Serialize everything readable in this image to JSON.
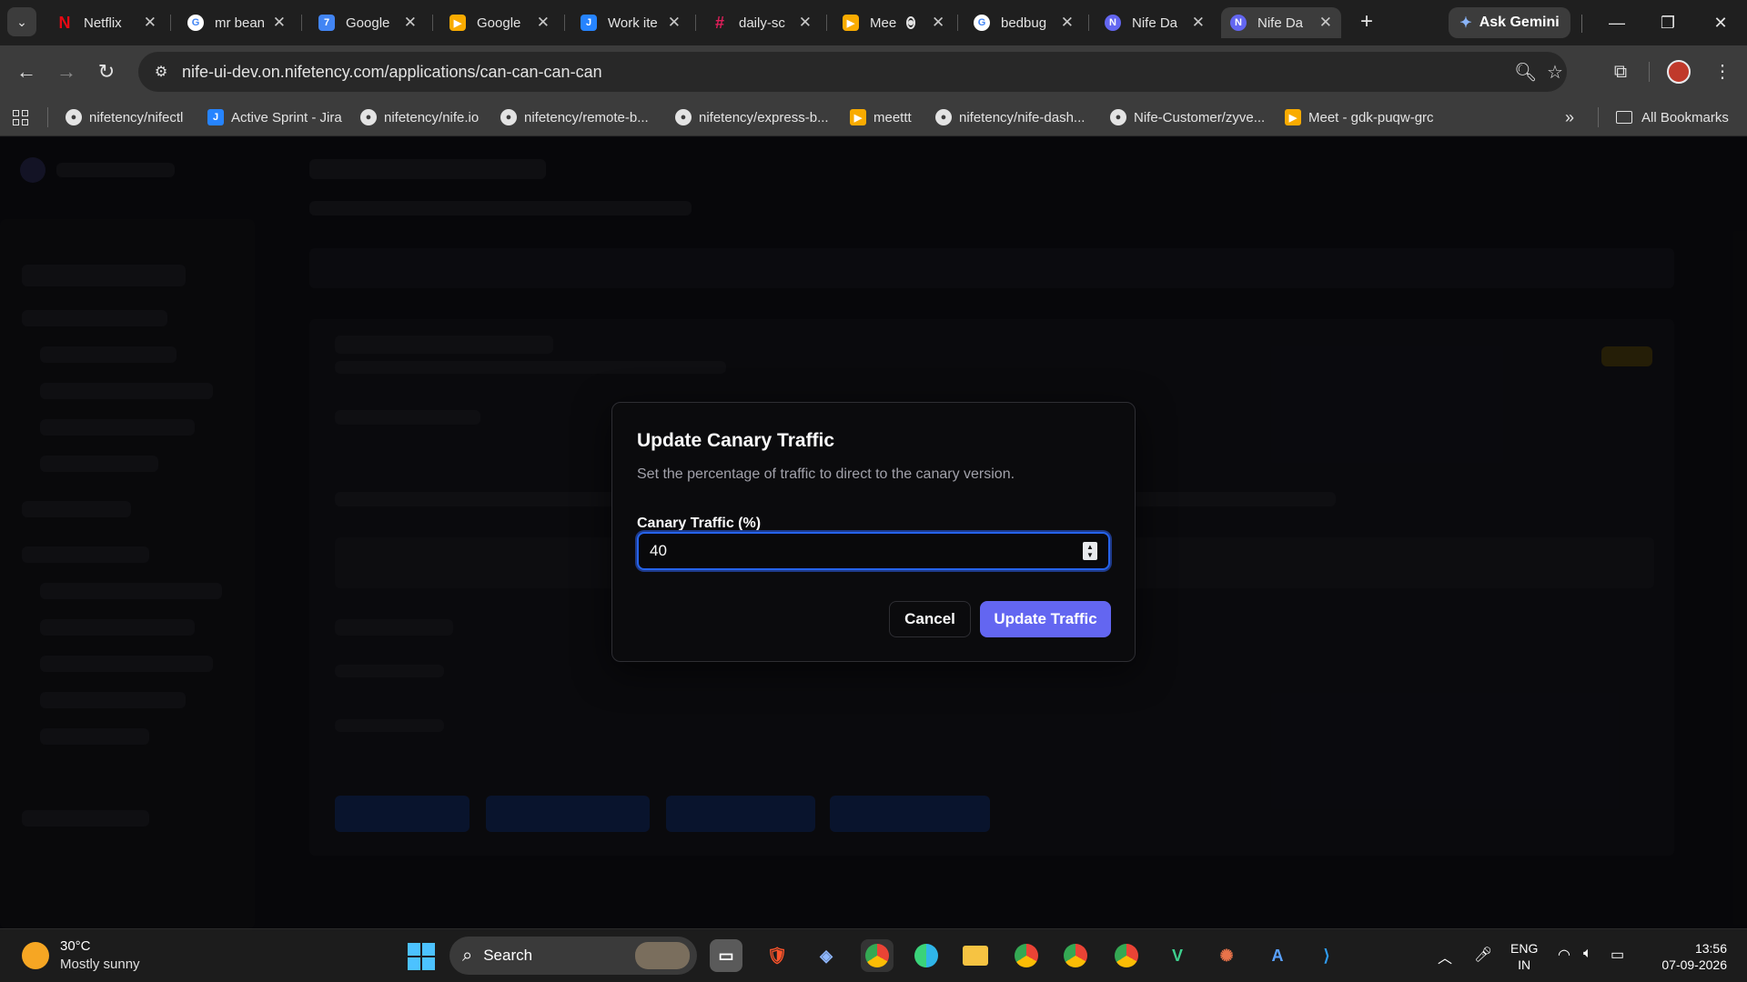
{
  "browser": {
    "tabs": [
      {
        "title": "Netflix",
        "icon": "netflix-icon",
        "color": "#e50914",
        "glyph": "N"
      },
      {
        "title": "mr bean",
        "icon": "google-icon",
        "color": "#4285f4",
        "glyph": "G"
      },
      {
        "title": "Google",
        "icon": "google-docs-icon",
        "color": "#4285f4",
        "glyph": "7"
      },
      {
        "title": "Google",
        "icon": "google-meet-icon",
        "color": "#f9ab00",
        "glyph": "▶"
      },
      {
        "title": "Work ite",
        "icon": "jira-icon",
        "color": "#2684ff",
        "glyph": "J"
      },
      {
        "title": "daily-sc",
        "icon": "slack-icon",
        "color": "#e01e5a",
        "glyph": "#"
      },
      {
        "title": "Mee",
        "icon": "google-meet-icon",
        "color": "#f9ab00",
        "glyph": "▶"
      },
      {
        "title": "bedbug",
        "icon": "google-icon",
        "color": "#4285f4",
        "glyph": "G"
      },
      {
        "title": "Nife Da",
        "icon": "nife-icon",
        "color": "#6366f1",
        "glyph": "N"
      },
      {
        "title": "Nife Da",
        "icon": "nife-icon",
        "color": "#6366f1",
        "glyph": "N"
      }
    ],
    "ask_gemini": "Ask Gemini",
    "url_host": "nife-ui-dev.on.nifetency.com",
    "url_path": "/applications/can-can-can-can",
    "bookmarks": [
      {
        "label": "nifetency/nifectl",
        "type": "gh"
      },
      {
        "label": "Active Sprint - Jira",
        "type": "jira"
      },
      {
        "label": "nifetency/nife.io",
        "type": "gh"
      },
      {
        "label": "nifetency/remote-b...",
        "type": "gh"
      },
      {
        "label": "nifetency/express-b...",
        "type": "gh"
      },
      {
        "label": "meettt",
        "type": "meet"
      },
      {
        "label": "nifetency/nife-dash...",
        "type": "gh"
      },
      {
        "label": "Nife-Customer/zyve...",
        "type": "gh"
      },
      {
        "label": "Meet - gdk-puqw-grc",
        "type": "meet"
      }
    ],
    "all_bookmarks": "All Bookmarks"
  },
  "modal": {
    "title": "Update Canary Traffic",
    "description": "Set the percentage of traffic to direct to the canary version.",
    "field_label": "Canary Traffic (%)",
    "field_value": "40",
    "cancel_label": "Cancel",
    "update_label": "Update Traffic"
  },
  "taskbar": {
    "temperature": "30°C",
    "weather": "Mostly sunny",
    "search_label": "Search",
    "lang_line1": "ENG",
    "lang_line2": "IN",
    "time": "13:56",
    "date": "07-09-2026"
  }
}
